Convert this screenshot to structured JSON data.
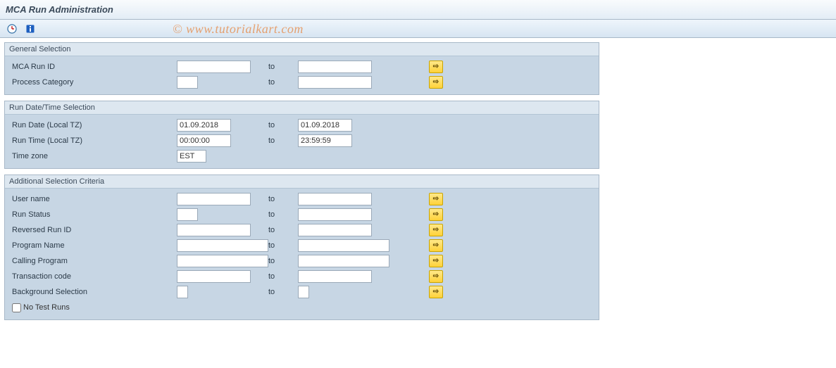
{
  "header": {
    "title": "MCA Run Administration",
    "watermark": "© www.tutorialkart.com"
  },
  "toolbar": {
    "icons": {
      "execute": "execute-icon",
      "info": "info-icon"
    }
  },
  "common": {
    "to_label": "to",
    "ext_aria": "Multiple selection"
  },
  "groups": {
    "general": {
      "title": "General Selection",
      "rows": {
        "mca_run_id": {
          "label": "MCA Run ID",
          "from": "",
          "to": "",
          "from_width": "in-full",
          "to_width": "in-full",
          "ext": true
        },
        "process_cat": {
          "label": "Process Category",
          "from": "",
          "to": "",
          "from_width": "in-short",
          "to_width": "in-full",
          "ext": true
        }
      }
    },
    "datetime": {
      "title": "Run Date/Time Selection",
      "rows": {
        "run_date": {
          "label": "Run Date (Local TZ)",
          "from": "01.09.2018",
          "to": "01.09.2018",
          "from_width": "in-date",
          "to_width": "in-date",
          "ext": false
        },
        "run_time": {
          "label": "Run Time (Local TZ)",
          "from": "00:00:00",
          "to": "23:59:59",
          "from_width": "in-date",
          "to_width": "in-date",
          "ext": false
        },
        "timezone": {
          "label": "Time zone",
          "from": "EST",
          "single": true,
          "from_width": "in-short"
        }
      }
    },
    "additional": {
      "title": "Additional Selection Criteria",
      "rows": {
        "user_name": {
          "label": "User name",
          "from": "",
          "to": "",
          "from_width": "in-full",
          "to_width": "in-full",
          "ext": true
        },
        "run_status": {
          "label": "Run Status",
          "from": "",
          "to": "",
          "from_width": "in-short",
          "to_width": "in-full",
          "ext": true
        },
        "reversed_id": {
          "label": "Reversed Run ID",
          "from": "",
          "to": "",
          "from_width": "in-full",
          "to_width": "in-full",
          "ext": true
        },
        "program_name": {
          "label": "Program Name",
          "from": "",
          "to": "",
          "from_width": "in-wide",
          "to_width": "in-wide",
          "ext": true
        },
        "calling_prog": {
          "label": "Calling Program",
          "from": "",
          "to": "",
          "from_width": "in-wide",
          "to_width": "in-wide",
          "ext": true
        },
        "tcode": {
          "label": "Transaction code",
          "from": "",
          "to": "",
          "from_width": "in-full",
          "to_width": "in-full",
          "ext": true
        },
        "bg_sel": {
          "label": "Background Selection",
          "from": "",
          "to": "",
          "from_width": "in-tiny",
          "to_width": "in-tiny",
          "ext": true
        }
      },
      "no_test_label": "No Test Runs",
      "no_test_checked": false
    }
  }
}
